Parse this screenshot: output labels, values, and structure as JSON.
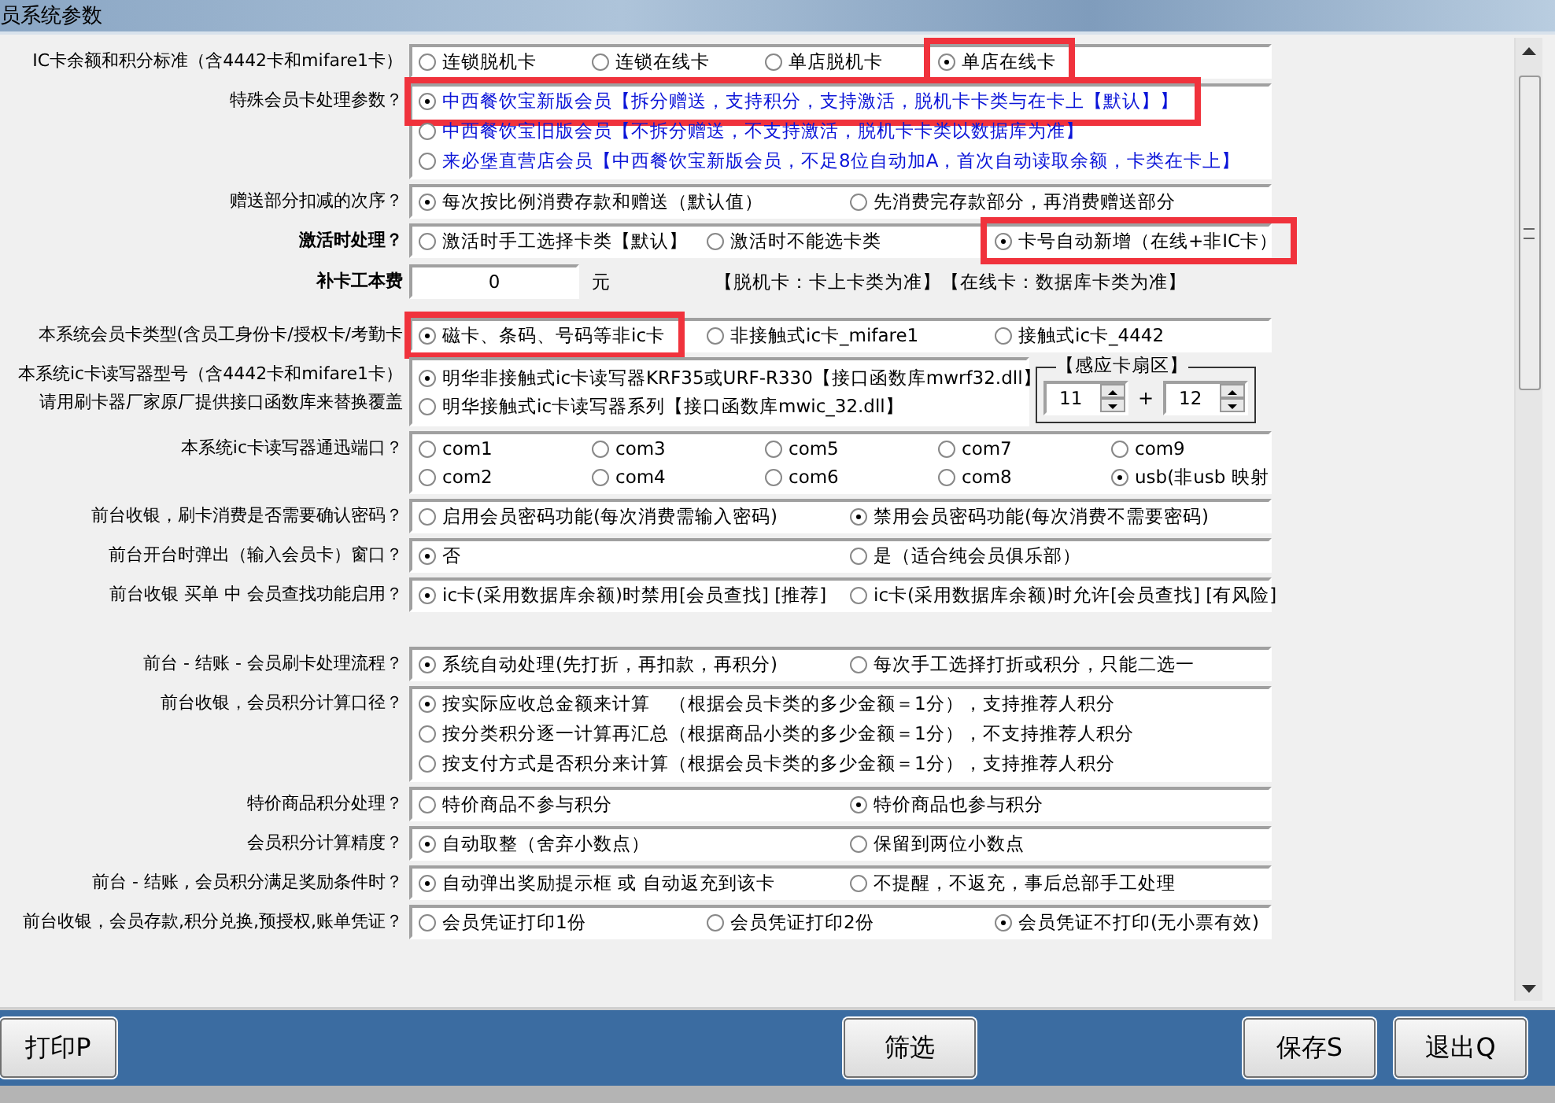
{
  "window": {
    "title": "员系统参数"
  },
  "groups": [
    {
      "rows": [
        {
          "kind": "inline",
          "label": [
            "IC卡余额和积分标准（含4442卡和mifare1卡）"
          ],
          "emphasis": false,
          "options": [
            {
              "text": "连锁脱机卡",
              "selected": false,
              "highlighted": false
            },
            {
              "text": "连锁在线卡",
              "selected": false,
              "highlighted": false
            },
            {
              "text": "单店脱机卡",
              "selected": false,
              "highlighted": false
            },
            {
              "text": "单店在线卡",
              "selected": true,
              "highlighted": true
            }
          ]
        },
        {
          "kind": "stack-notice",
          "label": [
            "特殊会员卡处理参数？"
          ],
          "emphasis": false,
          "options": [
            {
              "text": "中西餐饮宝新版会员【拆分赠送，支持积分，支持激活，脱机卡卡类与在卡上【默认】】",
              "selected": true,
              "highlighted": true
            },
            {
              "text": "中西餐饮宝旧版会员【不拆分赠送，不支持激活，脱机卡卡类以数据库为准】",
              "selected": false,
              "highlighted": false
            },
            {
              "text": "来必堡直营店会员【中西餐饮宝新版会员，不足8位自动加A，首次自动读取余额，卡类在卡上】",
              "selected": false,
              "highlighted": false
            }
          ]
        },
        {
          "kind": "inline",
          "label": [
            "赠送部分扣减的次序？"
          ],
          "emphasis": false,
          "options": [
            {
              "text": "每次按比例消费存款和赠送（默认值）",
              "selected": true,
              "highlighted": false
            },
            {
              "text": "先消费完存款部分，再消费赠送部分",
              "selected": false,
              "highlighted": false
            }
          ]
        },
        {
          "kind": "inline",
          "label": [
            "激活时处理？"
          ],
          "emphasis": true,
          "options": [
            {
              "text": "激活时手工选择卡类【默认】",
              "selected": false,
              "highlighted": false
            },
            {
              "text": "激活时不能选卡类",
              "selected": false,
              "highlighted": false
            },
            {
              "text": "卡号自动新增（在线+非IC卡）",
              "selected": true,
              "highlighted": true
            }
          ]
        },
        {
          "kind": "fee",
          "label": [
            "补卡工本费"
          ],
          "emphasis": true,
          "value": "0",
          "unit": "元",
          "note": "【脱机卡：卡上卡类为准】【在线卡：数据库卡类为准】"
        },
        {
          "kind": "inline",
          "label": [
            "本系统会员卡类型(含员工身份卡/授权卡/考勤卡"
          ],
          "emphasis": false,
          "options": [
            {
              "text": "磁卡、条码、号码等非ic卡",
              "selected": true,
              "highlighted": true
            },
            {
              "text": "非接触式ic卡_mifare1",
              "selected": false,
              "highlighted": false
            },
            {
              "text": "接触式ic卡_4442",
              "selected": false,
              "highlighted": false
            }
          ]
        },
        {
          "kind": "reader",
          "label": [
            "本系统ic卡读写器型号（含4442卡和mifare1卡）",
            "请用刷卡器厂家原厂提供接口函数库来替换覆盖"
          ],
          "emphasis": false,
          "options": [
            {
              "text": "明华非接触式ic卡读写器KRF35或URF-R330【接口函数库mwrf32.dll】",
              "selected": true,
              "highlighted": false
            },
            {
              "text": "明华接触式ic卡读写器系列【接口函数库mwic_32.dll】",
              "selected": false,
              "highlighted": false
            }
          ],
          "sector": {
            "title": "【感应卡扇区】",
            "from": "11",
            "joiner": "+",
            "to": "12"
          }
        },
        {
          "kind": "inline",
          "label": [
            "本系统ic卡读写器通迅端口？"
          ],
          "emphasis": false,
          "options": [
            {
              "text": "com1",
              "selected": false,
              "highlighted": false
            },
            {
              "text": "com3",
              "selected": false,
              "highlighted": false
            },
            {
              "text": "com5",
              "selected": false,
              "highlighted": false
            },
            {
              "text": "com7",
              "selected": false,
              "highlighted": false
            },
            {
              "text": "com9",
              "selected": false,
              "highlighted": false
            },
            {
              "text": "com2",
              "selected": false,
              "highlighted": false
            },
            {
              "text": "com4",
              "selected": false,
              "highlighted": false
            },
            {
              "text": "com6",
              "selected": false,
              "highlighted": false
            },
            {
              "text": "com8",
              "selected": false,
              "highlighted": false
            },
            {
              "text": "usb(非usb 映射",
              "selected": true,
              "highlighted": false
            }
          ]
        },
        {
          "kind": "inline",
          "label": [
            "前台收银，刷卡消费是否需要确认密码？"
          ],
          "emphasis": false,
          "options": [
            {
              "text": "启用会员密码功能(每次消费需输入密码)",
              "selected": false,
              "highlighted": false
            },
            {
              "text": "禁用会员密码功能(每次消费不需要密码)",
              "selected": true,
              "highlighted": false
            }
          ]
        },
        {
          "kind": "inline",
          "label": [
            "前台开台时弹出（输入会员卡）窗口？"
          ],
          "emphasis": false,
          "options": [
            {
              "text": "否",
              "selected": true,
              "highlighted": false
            },
            {
              "text": "是（适合纯会员俱乐部）",
              "selected": false,
              "highlighted": false
            }
          ]
        },
        {
          "kind": "inline",
          "label": [
            "前台收银 买单 中 会员查找功能启用？"
          ],
          "emphasis": false,
          "options": [
            {
              "text": "ic卡(采用数据库余额)时禁用[会员查找]  [推荐]",
              "selected": true,
              "highlighted": false
            },
            {
              "text": "ic卡(采用数据库余额)时允许[会员查找]  [有风险]",
              "selected": false,
              "highlighted": false
            }
          ]
        }
      ]
    },
    {
      "rows": [
        {
          "kind": "inline",
          "label": [
            "前台 - 结账 - 会员刷卡处理流程？"
          ],
          "emphasis": false,
          "options": [
            {
              "text": "系统自动处理(先打折，再扣款，再积分)",
              "selected": true,
              "highlighted": false
            },
            {
              "text": "每次手工选择打折或积分，只能二选一",
              "selected": false,
              "highlighted": false
            }
          ]
        },
        {
          "kind": "stack",
          "label": [
            "前台收银，会员积分计算口径？"
          ],
          "emphasis": false,
          "options": [
            {
              "text": "按实际应收总金额来计算　（根据会员卡类的多少金额＝1分），支持推荐人积分",
              "selected": true,
              "highlighted": false
            },
            {
              "text": "按分类积分逐一计算再汇总（根据商品小类的多少金额＝1分），不支持推荐人积分",
              "selected": false,
              "highlighted": false
            },
            {
              "text": "按支付方式是否积分来计算（根据会员卡类的多少金额＝1分），支持推荐人积分",
              "selected": false,
              "highlighted": false
            }
          ]
        },
        {
          "kind": "inline",
          "label": [
            "特价商品积分处理？"
          ],
          "emphasis": false,
          "options": [
            {
              "text": "特价商品不参与积分",
              "selected": false,
              "highlighted": false
            },
            {
              "text": "特价商品也参与积分",
              "selected": true,
              "highlighted": false
            }
          ]
        },
        {
          "kind": "inline",
          "label": [
            "会员积分计算精度？"
          ],
          "emphasis": false,
          "options": [
            {
              "text": "自动取整（舍弃小数点）",
              "selected": true,
              "highlighted": false
            },
            {
              "text": "保留到两位小数点",
              "selected": false,
              "highlighted": false
            }
          ]
        },
        {
          "kind": "inline",
          "label": [
            "前台 - 结账 , 会员积分满足奖励条件时？"
          ],
          "emphasis": false,
          "options": [
            {
              "text": "自动弹出奖励提示框 或 自动返充到该卡",
              "selected": true,
              "highlighted": false
            },
            {
              "text": "不提醒，不返充，事后总部手工处理",
              "selected": false,
              "highlighted": false
            }
          ]
        },
        {
          "kind": "inline",
          "label": [
            "前台收银，会员存款,积分兑换,预授权,账单凭证？"
          ],
          "emphasis": false,
          "options": [
            {
              "text": "会员凭证打印1份",
              "selected": false,
              "highlighted": false
            },
            {
              "text": "会员凭证打印2份",
              "selected": false,
              "highlighted": false
            },
            {
              "text": "会员凭证不打印(无小票有效)",
              "selected": true,
              "highlighted": false
            }
          ]
        }
      ]
    }
  ],
  "buttons": [
    {
      "label": "打印P"
    },
    {
      "label": "筛选"
    },
    {
      "label": "保存S"
    },
    {
      "label": "退出Q"
    }
  ]
}
